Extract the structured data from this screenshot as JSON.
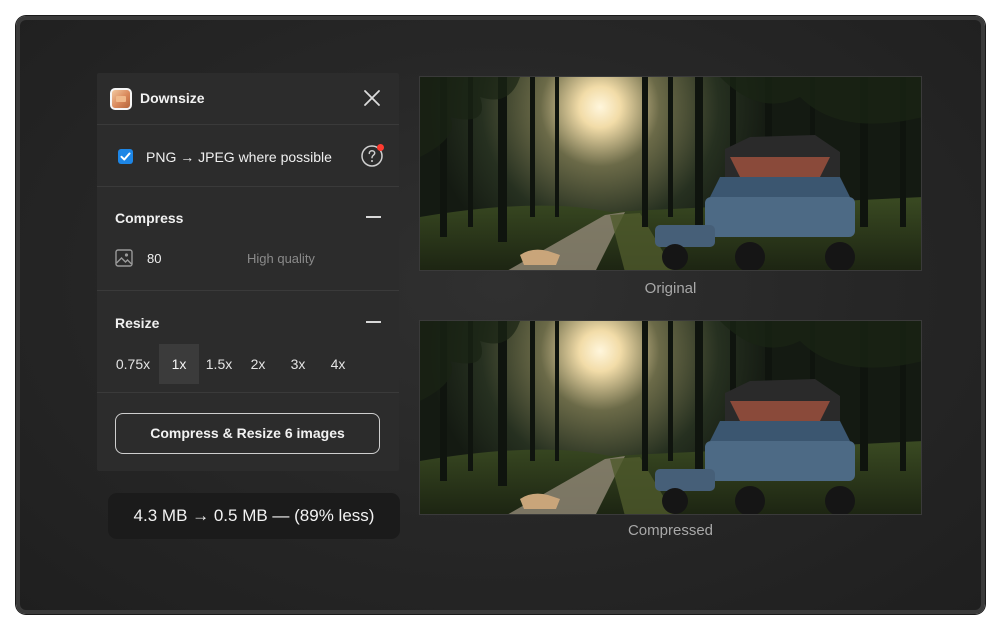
{
  "app": {
    "title": "Downsize",
    "icon": "package-icon",
    "close_icon": "close-icon"
  },
  "convert": {
    "label": "PNG → JPEG where possible",
    "checked": true,
    "help_icon": "help-icon",
    "accent": "#1d86e6",
    "notification_color": "#ff3b30"
  },
  "compress": {
    "title": "Compress",
    "quality_value": "80",
    "quality_label": "High quality",
    "icon": "image-icon"
  },
  "resize": {
    "title": "Resize",
    "scales": [
      "0.75x",
      "1x",
      "1.5x",
      "2x",
      "3x",
      "4x"
    ],
    "selected": "1x"
  },
  "action": {
    "label": "Compress & Resize 6 images"
  },
  "summary": {
    "text": "4.3 MB → 0.5 MB — (89% less)"
  },
  "preview": {
    "original_caption": "Original",
    "compressed_caption": "Compressed"
  }
}
